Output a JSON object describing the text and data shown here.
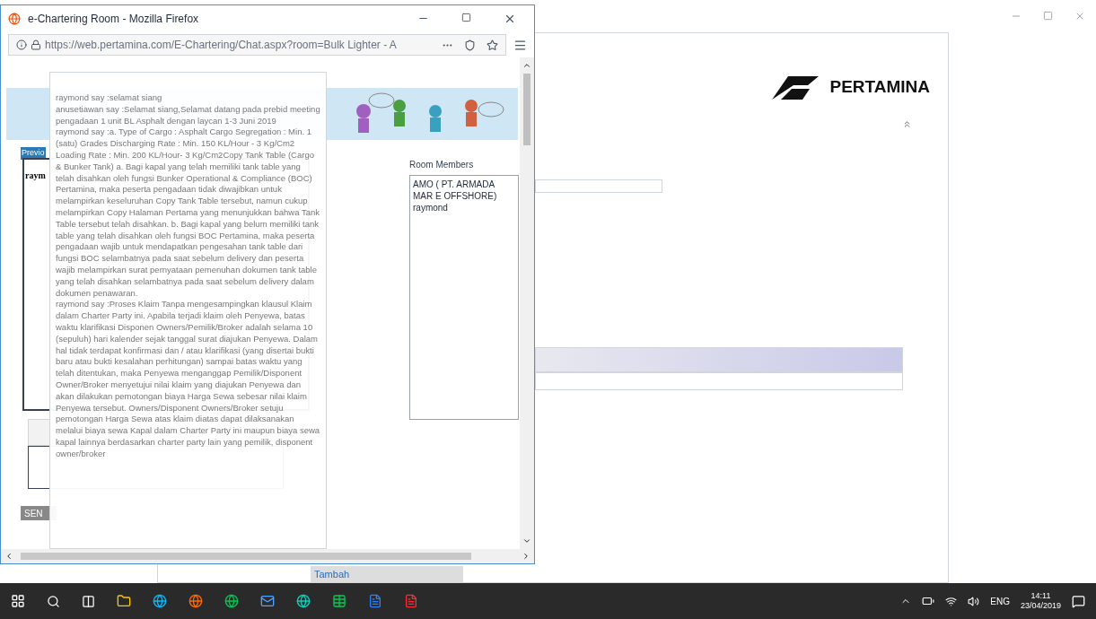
{
  "background_page": {
    "logo_text": "PERTAMINA",
    "add_button": "Tambah"
  },
  "browser_window": {
    "title": "e-Chartering Room - Mozilla Firefox",
    "url": "https://web.pertamina.com/E-Chartering/Chat.aspx?room=Bulk Lighter - A",
    "previous_tab": "Previo",
    "chat_log": "raym",
    "room_members_label": "Room Members",
    "room_members": [
      "AMO ( PT. ARMADA MAR E OFFSHORE)",
      "raymond"
    ],
    "send_button": "SEN"
  },
  "chat_tooltip": {
    "messages": [
      "raymond say :selamat siang",
      "anusetiawan say :Selamat siang,Selamat datang pada prebid meeting pengadaan 1 unit BL Asphalt dengan laycan 1-3 Juni 2019",
      "raymond say :a. Type of Cargo : Asphalt Cargo Segregation : Min. 1 (satu) Grades Discharging Rate : Min. 150 KL/Hour - 3 Kg/Cm2 Loading Rate : Min. 200 KL/Hour- 3 Kg/Cm2Copy Tank Table (Cargo & Bunker Tank) a. Bagi kapal yang telah memiliki tank table yang telah disahkan oleh fungsi Bunker Operational & Compliance (BOC) Pertamina, maka peserta pengadaan tidak diwajibkan untuk melampirkan keseluruhan Copy Tank Table tersebut, namun cukup melampirkan Copy Halaman Pertama yang menunjukkan bahwa Tank Table tersebut telah disahkan. b. Bagi kapal yang belum memiliki tank table yang telah disahkan oleh fungsi BOC Pertamina, maka peserta pengadaan wajib untuk mendapatkan pengesahan tank table dari fungsi BOC selambatnya pada saat sebelum delivery dan peserta wajib melampirkan surat pernyataan pemenuhan dokumen tank table yang telah disahkan selambatnya pada saat sebelum delivery dalam dokumen penawaran.",
      "raymond say :Proses Klaim Tanpa mengesampingkan klausul Klaim dalam Charter Party ini. Apabila terjadi klaim oleh Penyewa, batas waktu klarifikasi Disponen Owners/Pemilik/Broker adalah selama 10 (sepuluh) hari kalender sejak tanggal surat diajukan Penyewa. Dalam hal tidak terdapat konfirmasi dan / atau klarifikasi (yang disertai bukti baru atau bukti kesalahan perhitungan) sampai batas waktu yang telah ditentukan, maka Penyewa menganggap Pemilik/Disponent Owner/Broker menyetujui nilai klaim yang diajukan Penyewa dan akan dilakukan pemotongan biaya Harga Sewa sebesar nilai klaim Penyewa tersebut. Owners/Disponent Owners/Broker setuju pemotongan Harga Sewa atas klaim diatas dapat dilaksanakan melalui biaya sewa Kapal dalam Charter Party ini maupun biaya sewa kapal lainnya berdasarkan charter party lain yang pemilik, disponent owner/broker"
    ]
  },
  "taskbar": {
    "language": "ENG",
    "time": "14:11",
    "date": "23/04/2019"
  }
}
